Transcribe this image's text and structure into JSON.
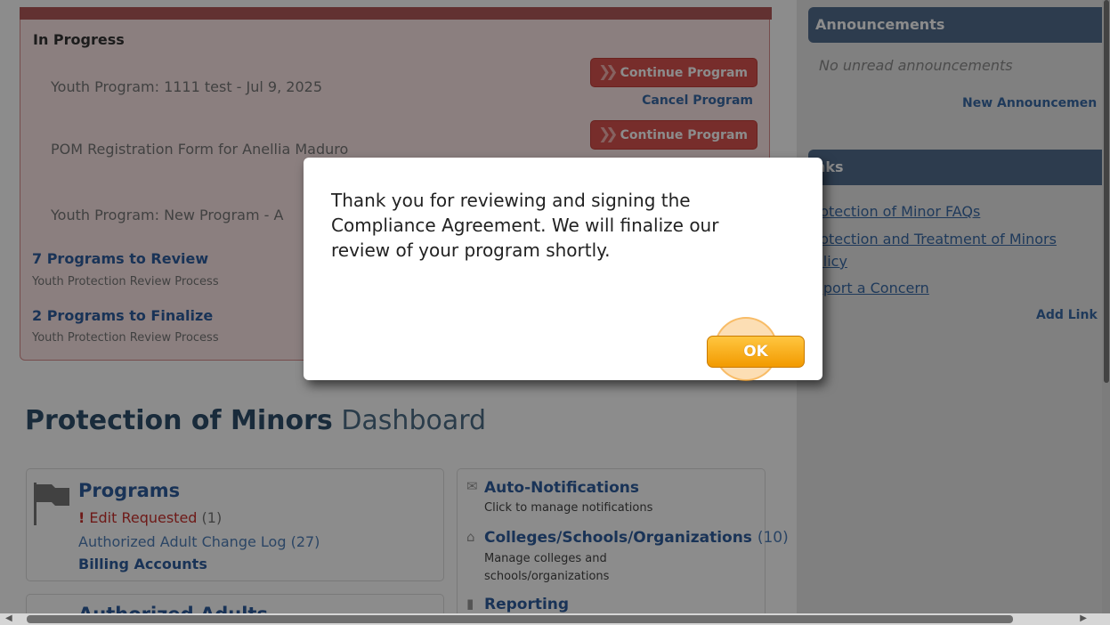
{
  "in_progress": {
    "title": "In Progress",
    "items": [
      {
        "label": "Youth Program: 1111 test - Jul 9, 2025"
      },
      {
        "label": "POM Registration Form for Anellia Maduro"
      },
      {
        "label": "Youth Program: New Program - A"
      }
    ],
    "continue_label": "Continue Program",
    "cancel_label": "Cancel Program"
  },
  "review": [
    {
      "title": "7 Programs to Review",
      "subtitle": "Youth Protection Review Process"
    },
    {
      "title": "2 Programs to Finalize",
      "subtitle": "Youth Protection Review Process"
    }
  ],
  "dashboard": {
    "title_bold": "Protection of Minors",
    "title_light": "Dashboard"
  },
  "programs_card": {
    "title": "Programs",
    "edit_mark": "!",
    "edit_requested": "Edit Requested",
    "edit_count": "(1)",
    "change_log": "Authorized Adult Change Log (27)",
    "billing": "Billing Accounts"
  },
  "right_card": {
    "auto_title": "Auto-Notifications",
    "auto_sub": "Click to manage notifications",
    "colleges_title": "Colleges/Schools/Organizations",
    "colleges_count": "(10)",
    "colleges_sub1": "Manage colleges and",
    "colleges_sub2": "schools/organizations",
    "reporting": "Reporting"
  },
  "next_card_partial": "Authorized Adults",
  "sidebar": {
    "announcements": {
      "header": "Announcements",
      "empty": "No unread announcements",
      "new_link": "New Announcemen"
    },
    "links": {
      "header": "nks",
      "items": [
        "rotection of Minor FAQs",
        "rotection and Treatment of Minors",
        "olicy",
        "eport a Concern"
      ],
      "add_link": "Add Link"
    }
  },
  "modal": {
    "message": "Thank you for reviewing and signing the Compliance Agreement. We will finalize our review of your program shortly.",
    "ok_label": "OK"
  },
  "colors": {
    "accent_red": "#d9534f",
    "link_blue": "#2f5e9e",
    "sidebar_header": "#536d8e",
    "ok_orange": "#f29a00"
  }
}
